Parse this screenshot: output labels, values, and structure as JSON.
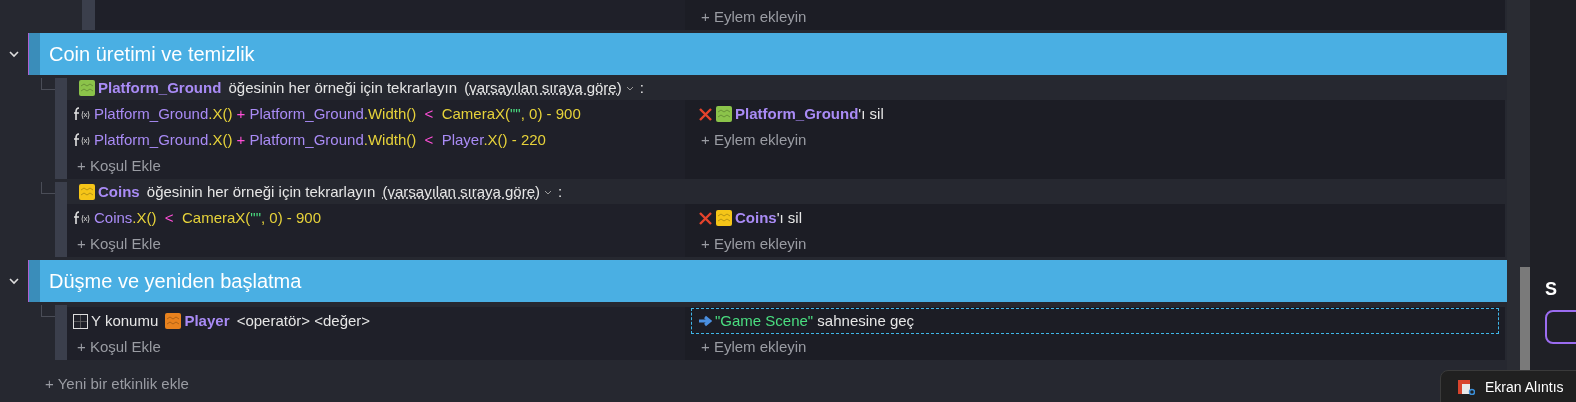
{
  "top_event": {
    "add_action": "+ Eylem ekleyin"
  },
  "groups": [
    {
      "title": "Coin üretimi ve temizlik",
      "expanded": true,
      "events": [
        {
          "kind": "foreach",
          "object": {
            "name": "Platform_Ground",
            "color": "#8bc34a"
          },
          "text": "öğesinin her örneği için tekrarlayın",
          "order": "(varsayılan sıraya göre)",
          "colon": ":",
          "conditions": [
            {
              "kind": "expression",
              "tokens": [
                {
                  "kind": "object",
                  "text": "Platform_Ground"
                },
                {
                  "kind": "call",
                  "text": ".X()"
                },
                {
                  "kind": "op",
                  "text": " + "
                },
                {
                  "kind": "object",
                  "text": "Platform_Ground"
                },
                {
                  "kind": "call",
                  "text": ".Width()"
                },
                {
                  "kind": "op",
                  "text": "  <  "
                },
                {
                  "kind": "call",
                  "text": "CameraX("
                },
                {
                  "kind": "string",
                  "text": "\"\""
                },
                {
                  "kind": "call",
                  "text": ", 0) - 900"
                }
              ]
            },
            {
              "kind": "expression",
              "tokens": [
                {
                  "kind": "object",
                  "text": "Platform_Ground"
                },
                {
                  "kind": "call",
                  "text": ".X()"
                },
                {
                  "kind": "op",
                  "text": " + "
                },
                {
                  "kind": "object",
                  "text": "Platform_Ground"
                },
                {
                  "kind": "call",
                  "text": ".Width()"
                },
                {
                  "kind": "op",
                  "text": "  <  "
                },
                {
                  "kind": "object",
                  "text": "Player"
                },
                {
                  "kind": "call",
                  "text": ".X() - 220"
                }
              ]
            }
          ],
          "add_condition": "+ Koşul Ekle",
          "actions": [
            {
              "kind": "delete",
              "object": {
                "name": "Platform_Ground",
                "color": "#8bc34a"
              },
              "text": "'ı sil",
              "selected": false
            }
          ],
          "add_action": "+ Eylem ekleyin"
        },
        {
          "kind": "foreach",
          "object": {
            "name": "Coins",
            "color": "#f5c518"
          },
          "text": "öğesinin her örneği için tekrarlayın",
          "order": "(varsayılan sıraya göre)",
          "colon": ":",
          "conditions": [
            {
              "kind": "expression",
              "tokens": [
                {
                  "kind": "object",
                  "text": "Coins"
                },
                {
                  "kind": "call",
                  "text": ".X()"
                },
                {
                  "kind": "op",
                  "text": "  <  "
                },
                {
                  "kind": "call",
                  "text": "CameraX("
                },
                {
                  "kind": "string",
                  "text": "\"\""
                },
                {
                  "kind": "call",
                  "text": ", 0) - 900"
                }
              ]
            }
          ],
          "add_condition": "+ Koşul Ekle",
          "actions": [
            {
              "kind": "delete",
              "object": {
                "name": "Coins",
                "color": "#f5c518"
              },
              "text": "'ı sil",
              "selected": false
            }
          ],
          "add_action": "+ Eylem ekleyin"
        }
      ]
    },
    {
      "title": "Düşme ve yeniden başlatma",
      "expanded": true,
      "events": [
        {
          "kind": "standard",
          "conditions": [
            {
              "kind": "compare",
              "label": "Y konumu",
              "object": {
                "name": "Player",
                "color": "#e8821e"
              },
              "text": "<operatör> <değer>"
            }
          ],
          "add_condition": "+ Koşul Ekle",
          "actions": [
            {
              "kind": "scene",
              "string": "\"Game Scene\"",
              "text": "sahnesine geç",
              "selected": true
            }
          ],
          "add_action": "+ Eylem ekleyin"
        }
      ]
    }
  ],
  "add_event": "+ Yeni bir etkinlik ekle",
  "side_panel": {
    "heading": "S"
  },
  "toast": {
    "label": "Ekran Alıntıs"
  }
}
